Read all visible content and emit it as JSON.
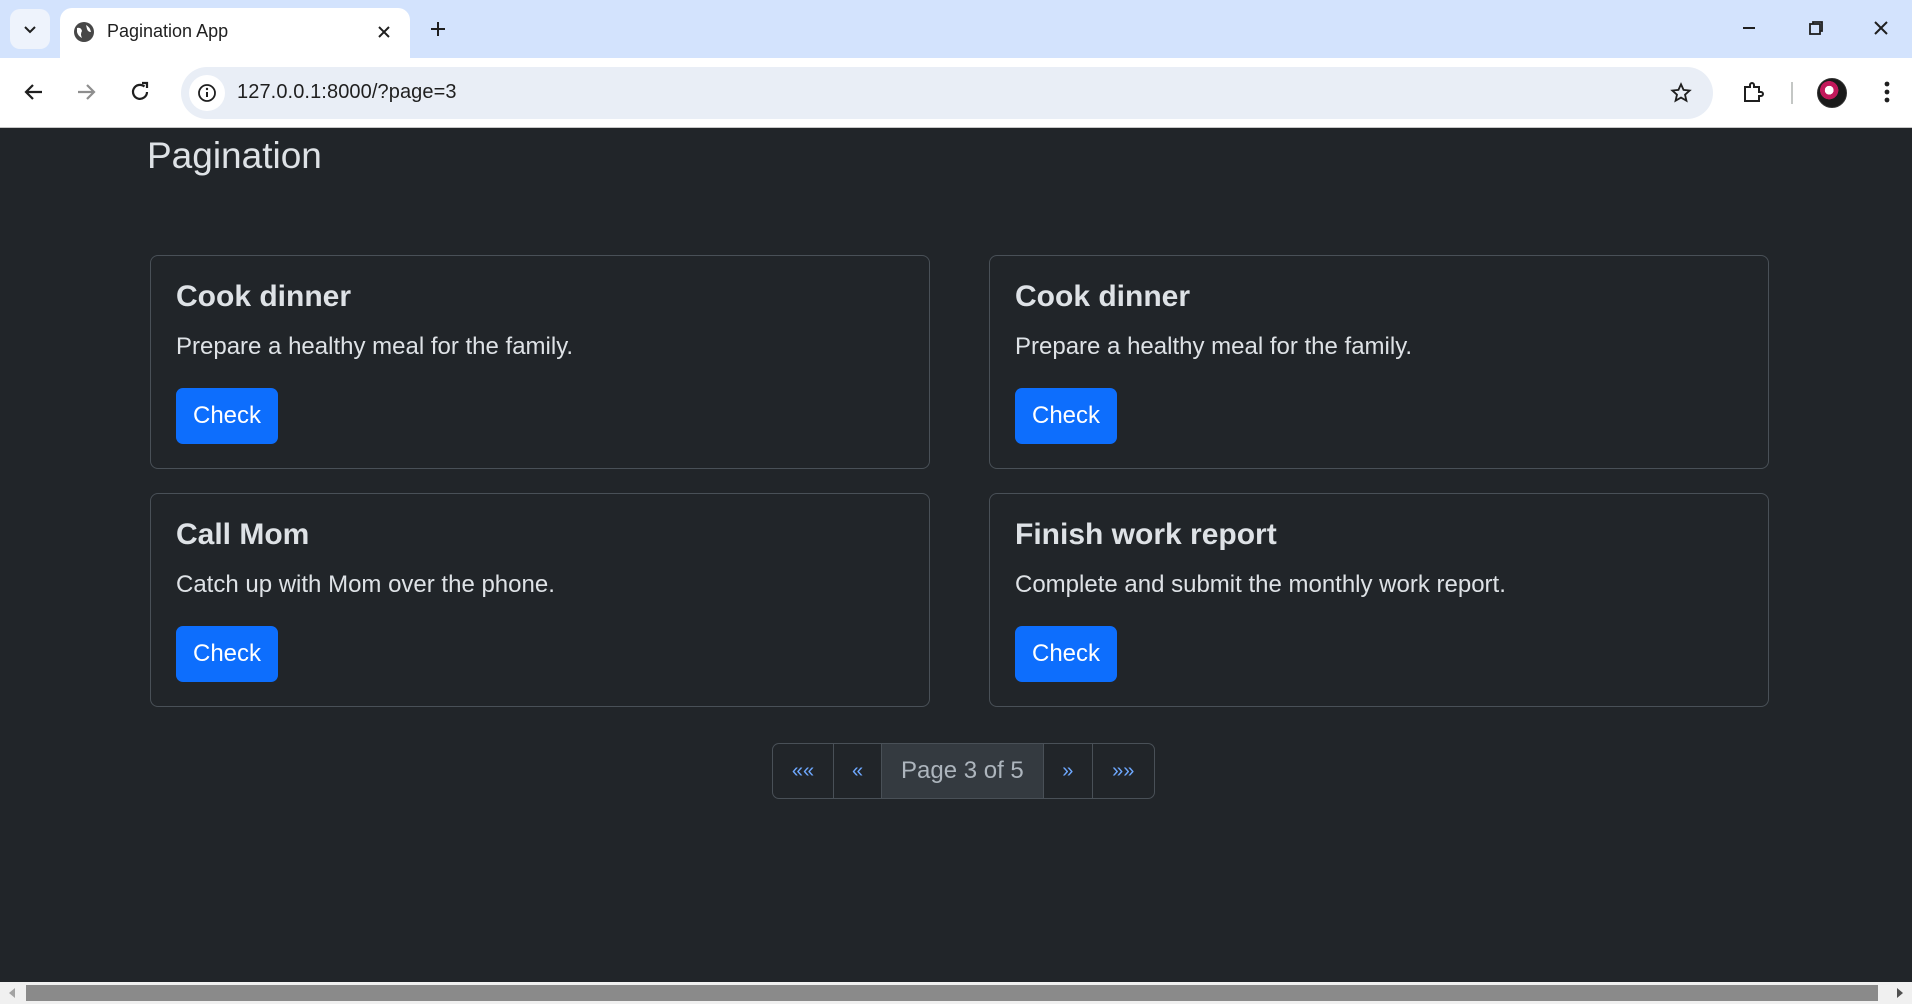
{
  "browser": {
    "tab_title": "Pagination App",
    "url": "127.0.0.1:8000/?page=3"
  },
  "page": {
    "title": "Pagination",
    "cards": [
      {
        "title": "Cook dinner",
        "text": "Prepare a healthy meal for the family.",
        "button": "Check"
      },
      {
        "title": "Cook dinner",
        "text": "Prepare a healthy meal for the family.",
        "button": "Check"
      },
      {
        "title": "Call Mom",
        "text": "Catch up with Mom over the phone.",
        "button": "Check"
      },
      {
        "title": "Finish work report",
        "text": "Complete and submit the monthly work report.",
        "button": "Check"
      }
    ],
    "pagination": {
      "first": "««",
      "prev": "«",
      "current": "Page 3 of 5",
      "next": "»",
      "last": "»»"
    }
  },
  "colors": {
    "background": "#212529",
    "primary": "#0d6efd",
    "link": "#6ea8fe",
    "chrome_tabstrip": "#d3e3fd"
  }
}
